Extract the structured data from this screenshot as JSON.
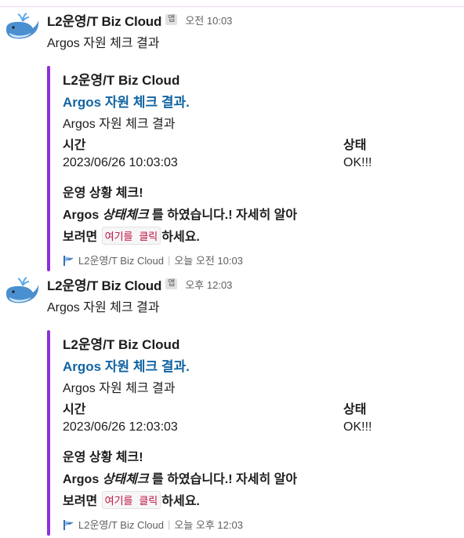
{
  "messages": [
    {
      "sender": "L2운영/T Biz Cloud",
      "app_badge": "앱",
      "time": "오전 10:03",
      "text": "Argos 자원 체크 결과",
      "attachment": {
        "author": "L2운영/T Biz Cloud",
        "title": "Argos 자원 체크 결과.",
        "text": "Argos 자원 체크 결과",
        "fields": [
          {
            "title": "시간",
            "value": "2023/06/26 10:03:03"
          },
          {
            "title": "상태",
            "value": "OK!!!"
          }
        ],
        "mrkdwn": {
          "heading": "운영 상황 체크!",
          "line1_bold": "Argos",
          "line1_bold_italic": "상태체크",
          "line1_rest": "를 하였습니다.! 자세히 알아",
          "line2_pre": "보려면",
          "line2_code": "여기를 클릭",
          "line2_post": "하세요."
        },
        "footer": "L2운영/T Biz Cloud",
        "footer_time": "오늘 오전 10:03"
      }
    },
    {
      "sender": "L2운영/T Biz Cloud",
      "app_badge": "앱",
      "time": "오후 12:03",
      "text": "Argos 자원 체크 결과",
      "attachment": {
        "author": "L2운영/T Biz Cloud",
        "title": "Argos 자원 체크 결과.",
        "text": "Argos 자원 체크 결과",
        "fields": [
          {
            "title": "시간",
            "value": "2023/06/26 12:03:03"
          },
          {
            "title": "상태",
            "value": "OK!!!"
          }
        ],
        "mrkdwn": {
          "heading": "운영 상황 체크!",
          "line1_bold": "Argos",
          "line1_bold_italic": "상태체크",
          "line1_rest": "를 하였습니다.! 자세히 알아",
          "line2_pre": "보려면",
          "line2_code": "여기를 클릭",
          "line2_post": "하세요."
        },
        "footer": "L2운영/T Biz Cloud",
        "footer_time": "오늘 오후 12:03"
      }
    }
  ],
  "colors": {
    "attachment_bar": "#8c2fdb",
    "link": "#1264a3",
    "code_text": "#c01343"
  },
  "icons": {
    "avatar": "whale-icon",
    "footer": "flag-icon"
  }
}
